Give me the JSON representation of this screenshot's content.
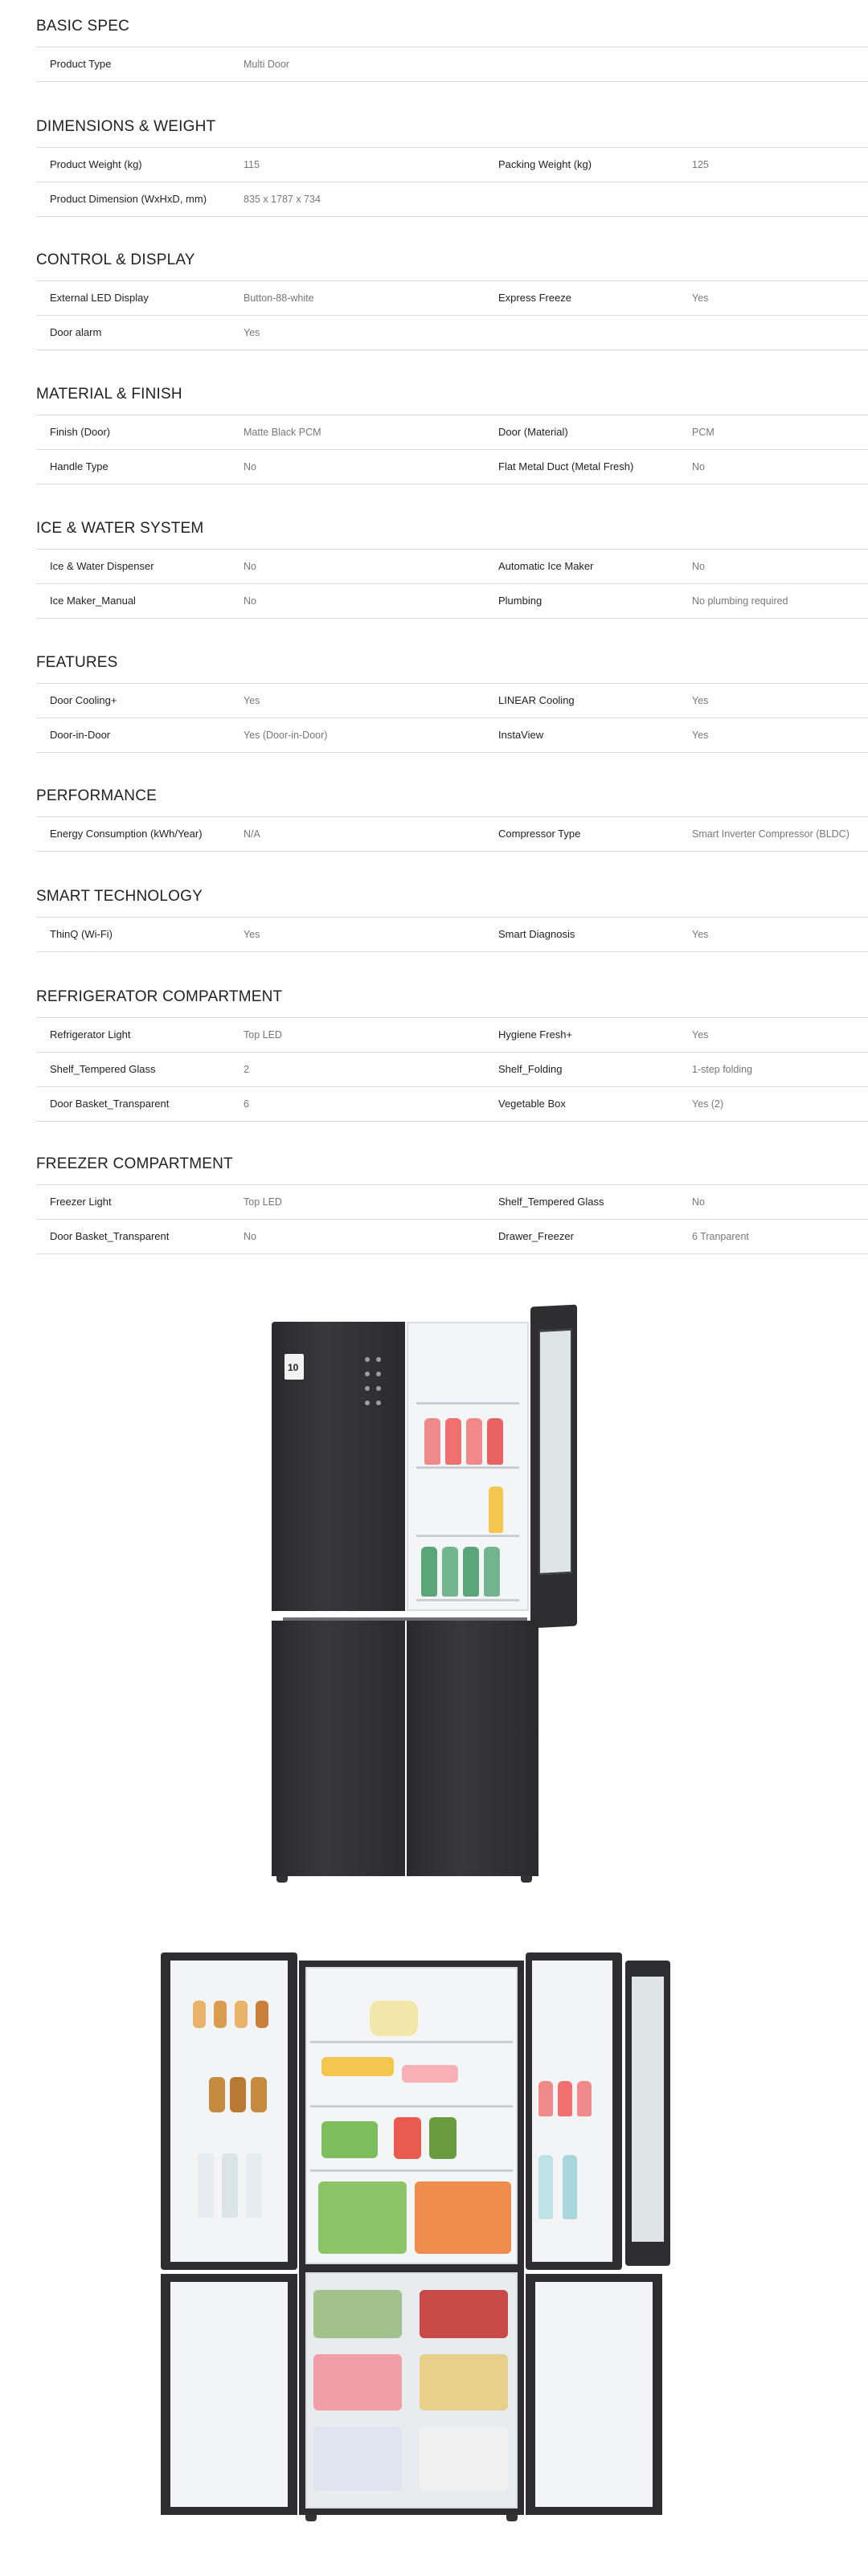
{
  "sections": [
    {
      "title": "BASIC SPEC",
      "rows": [
        [
          [
            "Product Type",
            "Multi Door"
          ]
        ]
      ]
    },
    {
      "title": "DIMENSIONS & WEIGHT",
      "rows": [
        [
          [
            "Product Weight (kg)",
            "115"
          ],
          [
            "Packing Weight (kg)",
            "125"
          ]
        ],
        [
          [
            "Product Dimension (WxHxD, mm)",
            "835 x 1787 x 734"
          ]
        ]
      ]
    },
    {
      "title": "CONTROL & DISPLAY",
      "rows": [
        [
          [
            "External LED Display",
            "Button-88-white"
          ],
          [
            "Express Freeze",
            "Yes"
          ]
        ],
        [
          [
            "Door alarm",
            "Yes"
          ]
        ]
      ]
    },
    {
      "title": "MATERIAL & FINISH",
      "rows": [
        [
          [
            "Finish (Door)",
            "Matte Black PCM"
          ],
          [
            "Door (Material)",
            "PCM"
          ]
        ],
        [
          [
            "Handle Type",
            "No"
          ],
          [
            "Flat Metal Duct (Metal Fresh)",
            "No"
          ]
        ]
      ]
    },
    {
      "title": "ICE & WATER SYSTEM",
      "rows": [
        [
          [
            "Ice & Water Dispenser",
            "No"
          ],
          [
            "Automatic Ice Maker",
            "No"
          ]
        ],
        [
          [
            "Ice Maker_Manual",
            "No"
          ],
          [
            "Plumbing",
            "No plumbing required"
          ]
        ]
      ]
    },
    {
      "title": "FEATURES",
      "rows": [
        [
          [
            "Door Cooling+",
            "Yes"
          ],
          [
            "LINEAR Cooling",
            "Yes"
          ]
        ],
        [
          [
            "Door-in-Door",
            "Yes (Door-in-Door)"
          ],
          [
            "InstaView",
            "Yes"
          ]
        ]
      ]
    },
    {
      "title": "PERFORMANCE",
      "rows": [
        [
          [
            "Energy Consumption (kWh/Year)",
            "N/A"
          ],
          [
            "Compressor Type",
            "Smart Inverter Compressor (BLDC)"
          ]
        ]
      ]
    },
    {
      "title": "SMART TECHNOLOGY",
      "rows": [
        [
          [
            "ThinQ (Wi-Fi)",
            "Yes"
          ],
          [
            "Smart Diagnosis",
            "Yes"
          ]
        ]
      ]
    },
    {
      "title": "REFRIGERATOR COMPARTMENT",
      "rows": [
        [
          [
            "Refrigerator Light",
            "Top LED"
          ],
          [
            "Hygiene Fresh+",
            "Yes"
          ]
        ],
        [
          [
            "Shelf_Tempered Glass",
            "2"
          ],
          [
            "Shelf_Folding",
            "1-step folding"
          ]
        ],
        [
          [
            "Door Basket_Transparent",
            "6"
          ],
          [
            "Vegetable Box",
            "Yes (2)"
          ]
        ]
      ]
    },
    {
      "title": "FREEZER COMPARTMENT",
      "rows": [
        [
          [
            "Freezer Light",
            "Top LED"
          ],
          [
            "Shelf_Tempered Glass",
            "No"
          ]
        ],
        [
          [
            "Door Basket_Transparent",
            "No"
          ],
          [
            "Drawer_Freezer",
            "6 Tranparent"
          ]
        ]
      ]
    }
  ],
  "images": {
    "closed_view": {
      "icon": "refrigerator-instaview-image",
      "badge": "10"
    },
    "open_view": {
      "icon": "refrigerator-open-doors-image"
    }
  },
  "colors": {
    "fridge_body": "#2e2e30",
    "interior": "#f4f5f6",
    "divider": "#dcdcdc"
  }
}
